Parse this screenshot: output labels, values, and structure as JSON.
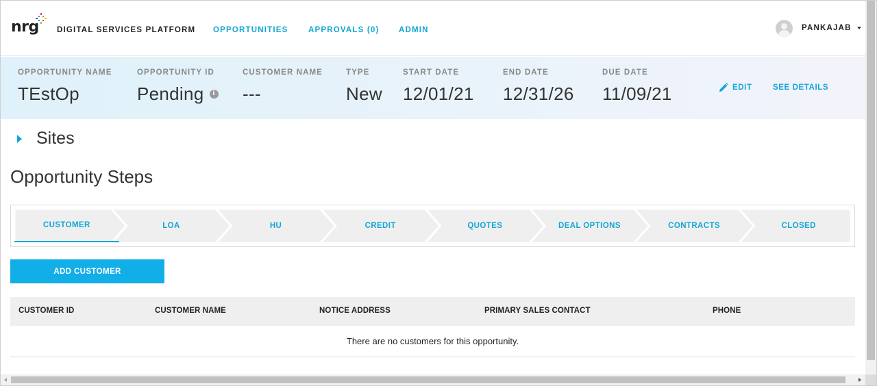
{
  "header": {
    "logo_text": "nrg",
    "platform_name": "DIGITAL SERVICES PLATFORM",
    "nav": {
      "opportunities": "OPPORTUNITIES",
      "approvals": "APPROVALS (0)",
      "admin": "ADMIN"
    },
    "user": {
      "name": "PANKAJAB",
      "avatar_icon": "user-avatar-icon",
      "menu_icon": "caret-down-icon"
    }
  },
  "summary": {
    "opportunity_name": {
      "label": "OPPORTUNITY NAME",
      "value": "TEstOp"
    },
    "opportunity_id": {
      "label": "OPPORTUNITY ID",
      "value": "Pending",
      "icon": "info-icon"
    },
    "customer_name": {
      "label": "CUSTOMER NAME",
      "value": "---"
    },
    "type": {
      "label": "TYPE",
      "value": "New"
    },
    "start_date": {
      "label": "START DATE",
      "value": "12/01/21"
    },
    "end_date": {
      "label": "END DATE",
      "value": "12/31/26"
    },
    "due_date": {
      "label": "DUE DATE",
      "value": "11/09/21"
    },
    "edit_label": "EDIT",
    "edit_icon": "pencil-icon",
    "see_details_label": "SEE DETAILS"
  },
  "sites": {
    "label": "Sites",
    "icon": "caret-right-icon"
  },
  "steps": {
    "title": "Opportunity Steps",
    "active_index": 0,
    "items": [
      {
        "label": "CUSTOMER"
      },
      {
        "label": "LOA"
      },
      {
        "label": "HU"
      },
      {
        "label": "CREDIT"
      },
      {
        "label": "QUOTES"
      },
      {
        "label": "DEAL OPTIONS"
      },
      {
        "label": "CONTRACTS"
      },
      {
        "label": "CLOSED"
      }
    ]
  },
  "customers": {
    "add_button_label": "ADD CUSTOMER",
    "columns": [
      "CUSTOMER ID",
      "CUSTOMER NAME",
      "NOTICE ADDRESS",
      "PRIMARY SALES CONTACT",
      "PHONE"
    ],
    "empty_message": "There are no customers for this opportunity."
  },
  "colors": {
    "accent": "#12a6d6",
    "button": "#12aee8",
    "step_bg": "#efefef",
    "table_header_bg": "#efefef"
  }
}
